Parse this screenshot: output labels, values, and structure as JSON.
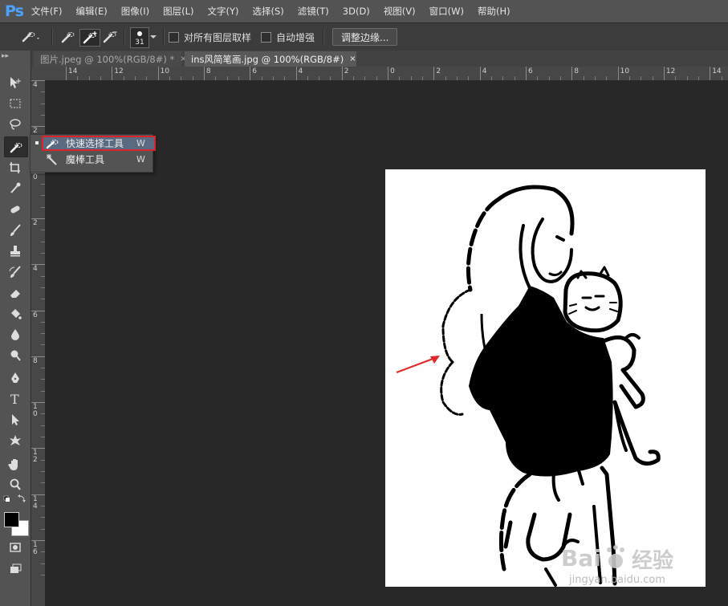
{
  "app": {
    "logo": "Ps",
    "menu": [
      "文件(F)",
      "编辑(E)",
      "图像(I)",
      "图层(L)",
      "文字(Y)",
      "选择(S)",
      "滤镜(T)",
      "3D(D)",
      "视图(V)",
      "窗口(W)",
      "帮助(H)"
    ]
  },
  "options": {
    "brush_size": "31",
    "sample_all_layers": "对所有图层取样",
    "auto_enhance": "自动增强",
    "refine_edge": "调整边缘..."
  },
  "tabs": [
    {
      "label": "图片.jpeg @ 100%(RGB/8#) *",
      "close": "×"
    },
    {
      "label": "ins风简笔画.jpg @ 100%(RGB/8#)",
      "close": "×"
    }
  ],
  "ruler": {
    "top": [
      "14",
      "12",
      "10",
      "8",
      "6",
      "4",
      "2",
      "0",
      "2",
      "4",
      "6",
      "8",
      "10",
      "12",
      "14"
    ],
    "left": [
      "4",
      "2",
      "0",
      "2",
      "4",
      "6",
      "8",
      "10",
      "12",
      "14",
      "16"
    ]
  },
  "flyout": [
    {
      "label": "快速选择工具",
      "key": "W",
      "icon": "quick-selection-icon"
    },
    {
      "label": "魔棒工具",
      "key": "W",
      "icon": "magic-wand-icon"
    }
  ],
  "watermark": {
    "text": "Bai 经验",
    "sub": "jingyan.baidu.com"
  },
  "colors": {
    "highlight": "#d8242a",
    "arrow": "#e02a2a",
    "ps_blue": "#4aa4ff"
  }
}
